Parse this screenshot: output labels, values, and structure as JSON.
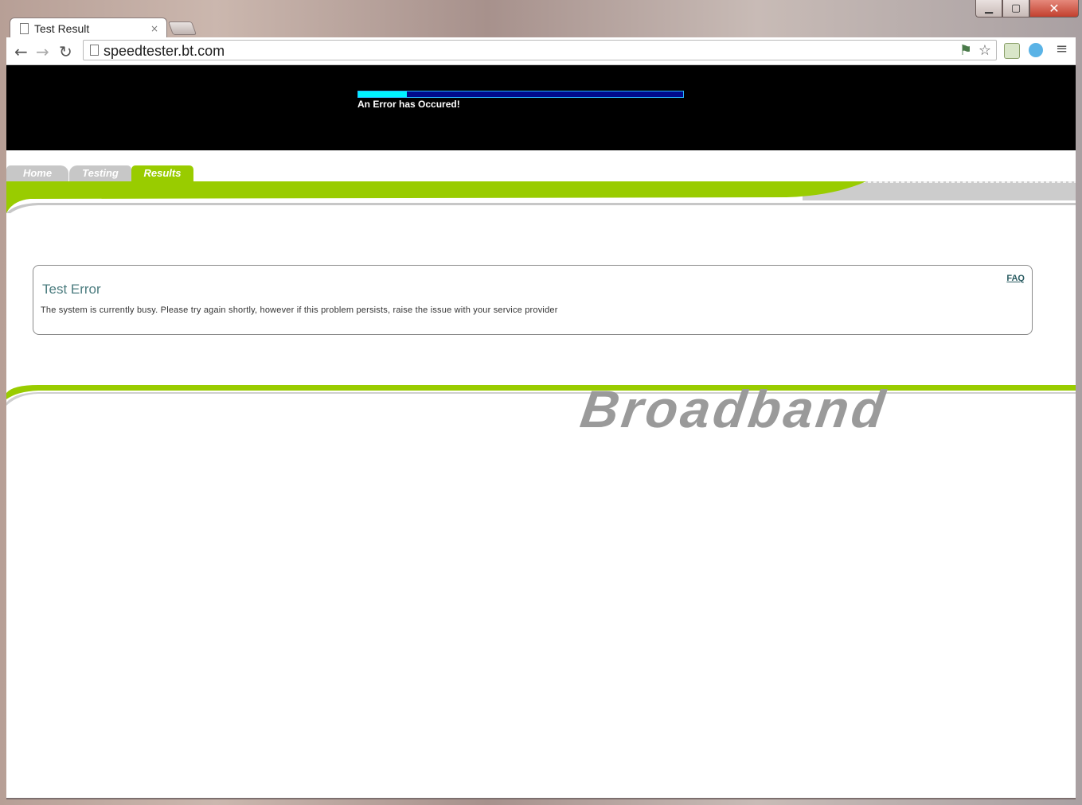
{
  "window": {
    "minimize_icon": "minimize-icon",
    "maximize_icon": "maximize-icon",
    "close_icon": "close-icon"
  },
  "browser": {
    "tab_title": "Test Result",
    "tab_close": "×",
    "url": "speedtester.bt.com"
  },
  "banner": {
    "progress_fraction": 0.15,
    "error_message": "An Error has Occured!"
  },
  "nav": {
    "tabs": [
      {
        "label": "Home",
        "active": false
      },
      {
        "label": "Testing",
        "active": false
      },
      {
        "label": "Results",
        "active": true
      }
    ]
  },
  "result": {
    "title": "Test Error",
    "message": "The system is currently busy. Please try again shortly, however if this problem persists, raise the issue with your service provider",
    "faq_label": "FAQ"
  },
  "brand": {
    "wordmark": "Broadband"
  },
  "colors": {
    "accent_green": "#99cc00",
    "banner_black": "#000000",
    "progress_fill": "#00f4ff",
    "progress_track": "#000a8c",
    "title_teal": "#4b7c7f"
  }
}
